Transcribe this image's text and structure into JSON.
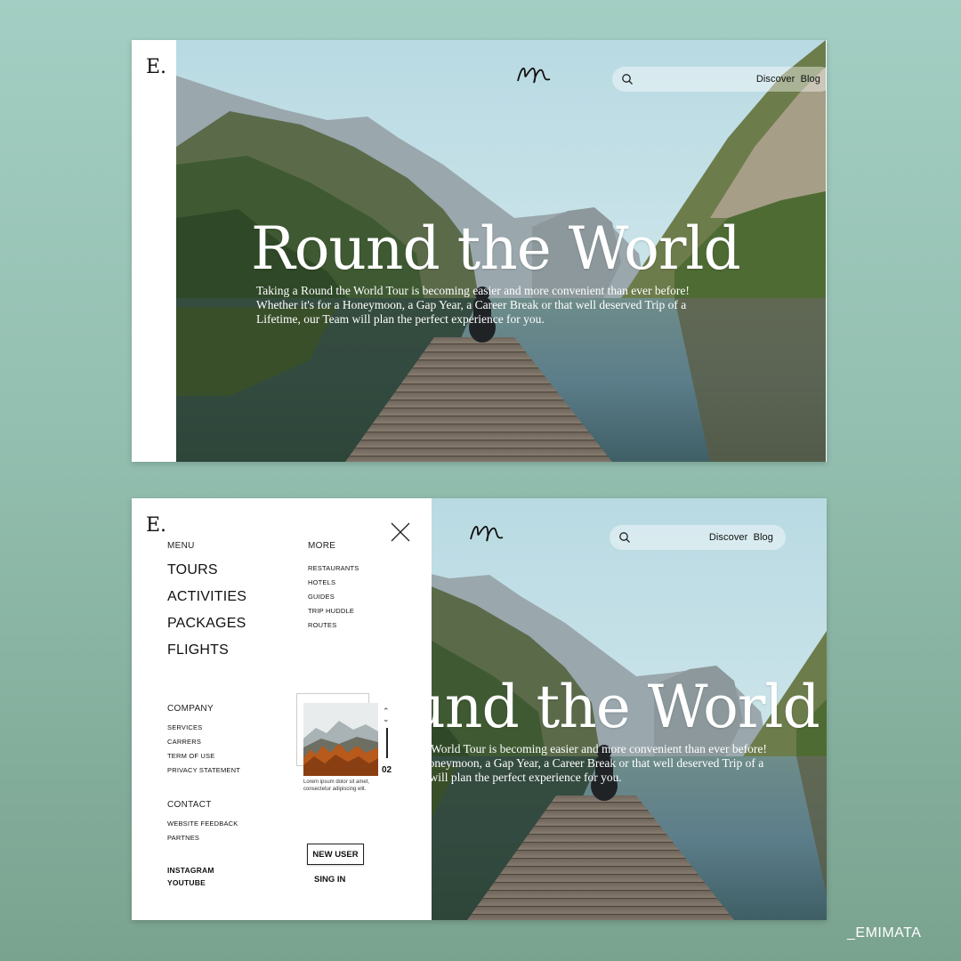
{
  "brand": {
    "logo_letter": "E."
  },
  "nav": {
    "discover": "Discover",
    "blog": "Blog"
  },
  "hero": {
    "title": "Round the World",
    "description": "Taking a Round the World Tour is becoming easier and more convenient than ever before!  Whether it's for a Honeymoon, a Gap Year, a Career Break or that well deserved Trip of a Lifetime, our Team will plan the perfect experience for you."
  },
  "menu": {
    "menu_label": "MENU",
    "main_items": [
      "TOURS",
      "ACTIVITIES",
      "PACKAGES",
      "FLIGHTS"
    ],
    "more_label": "MORE",
    "more_items": [
      "RESTAURANTS",
      "HOTELS",
      "GUIDES",
      "TRIP HUDDLE",
      "ROUTES"
    ],
    "company_label": "COMPANY",
    "company_items": [
      "SERVICES",
      "CARRERS",
      "TERM OF USE",
      "PRIVACY STATEMENT"
    ],
    "contact_label": "CONTACT",
    "contact_items": [
      "WEBSITE FEEDBACK",
      "PARTNES"
    ],
    "social_items": [
      "INSTAGRAM",
      "YOUTUBE"
    ],
    "slider_number": "02",
    "slider_caption": "Lorem ipsum dolor sit amet, consectetur adipiscing elit.",
    "new_user": "NEW USER",
    "sign_in": "SING IN"
  },
  "watermark": "_EMIMATA",
  "icons": [
    "search-icon",
    "close-icon",
    "signature-logo",
    "chevron-up-icon",
    "chevron-down-icon"
  ]
}
